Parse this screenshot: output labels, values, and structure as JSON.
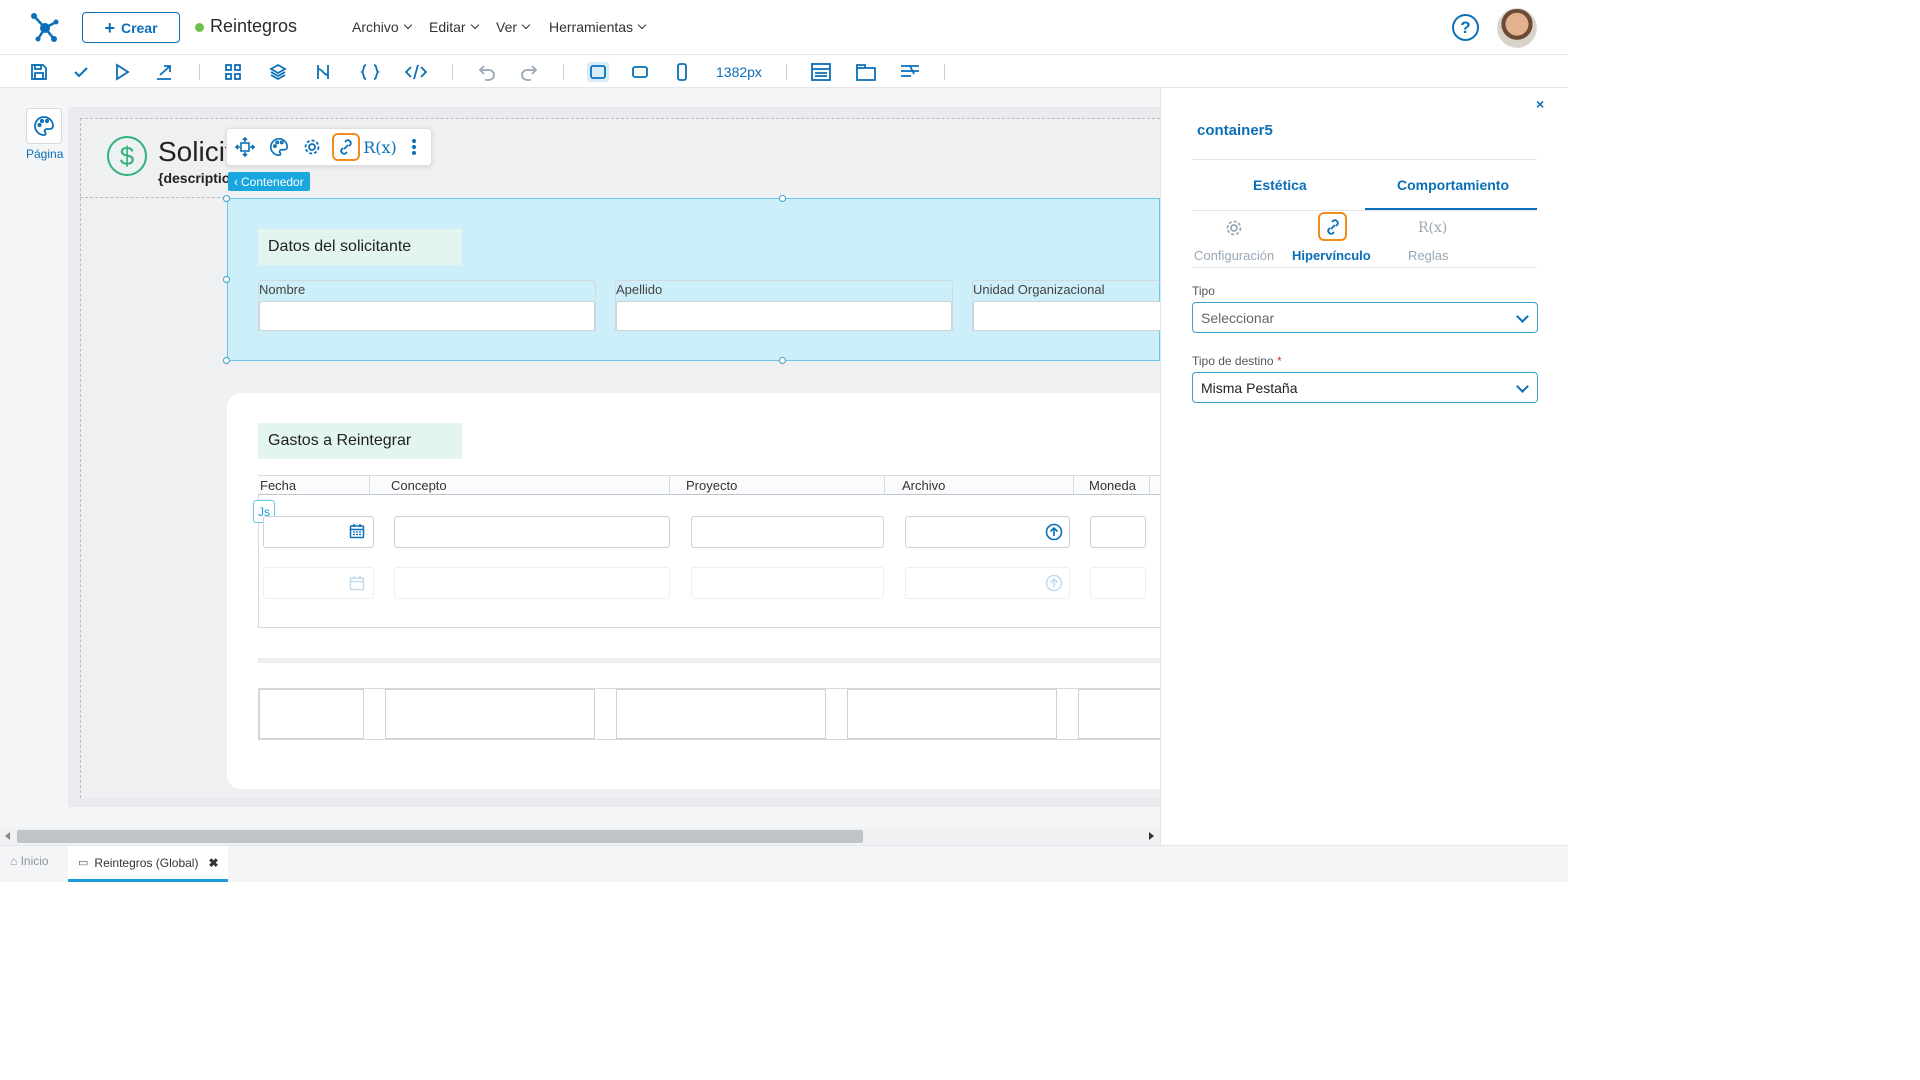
{
  "header": {
    "create_label": "Crear",
    "app_title": "Reintegros",
    "app_status_color": "#6cc24a",
    "menus": [
      "Archivo",
      "Editar",
      "Ver",
      "Herramientas"
    ],
    "help_icon": "help-circle-icon",
    "avatar": "user-avatar"
  },
  "toolbar": {
    "icons": [
      "save-icon",
      "check-icon",
      "play-icon",
      "export-icon",
      "grid-icon",
      "layers-icon",
      "flow-icon",
      "braces-icon",
      "code-icon",
      "undo-icon",
      "redo-icon",
      "desktop-icon",
      "tablet-icon",
      "mobile-icon",
      "layout-header-icon",
      "layout-tabs-icon",
      "layout-align-icon"
    ],
    "width_label": "1382px"
  },
  "page_button": {
    "label": "Página",
    "icon": "palette-icon"
  },
  "form": {
    "title": "Solicitud de Reintegro",
    "description": "{description}",
    "floating_toolbar": [
      "move-icon",
      "palette-icon",
      "gear-icon",
      "link-icon",
      "rules-icon",
      "more-vert-icon"
    ],
    "rules_label": "R(x)",
    "container_tag": "Contenedor"
  },
  "section1": {
    "title": "Datos del solicitante",
    "fields": [
      {
        "label": "Nombre",
        "value": ""
      },
      {
        "label": "Apellido",
        "value": ""
      },
      {
        "label": "Unidad Organizacional",
        "value": ""
      }
    ]
  },
  "section2": {
    "title": "Gastos a Reintegrar",
    "columns": [
      "Fecha",
      "Concepto",
      "Proyecto",
      "Archivo",
      "Moneda"
    ],
    "js_badge": "Js"
  },
  "panel": {
    "control_name": "container5",
    "tabs": [
      "Estética",
      "Comportamiento"
    ],
    "active_tab": "Comportamiento",
    "subtabs": [
      "Configuración",
      "Hipervínculo",
      "Reglas"
    ],
    "active_subtab": "Hipervínculo",
    "tipo_label": "Tipo",
    "tipo_value": "Seleccionar",
    "destino_label": "Tipo de destino",
    "destino_required": "*",
    "destino_value": "Misma Pestaña",
    "close": "×"
  },
  "bottom_tabs": {
    "home": "Inicio",
    "active": "Reintegros (Global)"
  },
  "colors": {
    "accent": "#0b6fb8",
    "highlight": "#f08c1e",
    "selection": "#cdeffa"
  }
}
